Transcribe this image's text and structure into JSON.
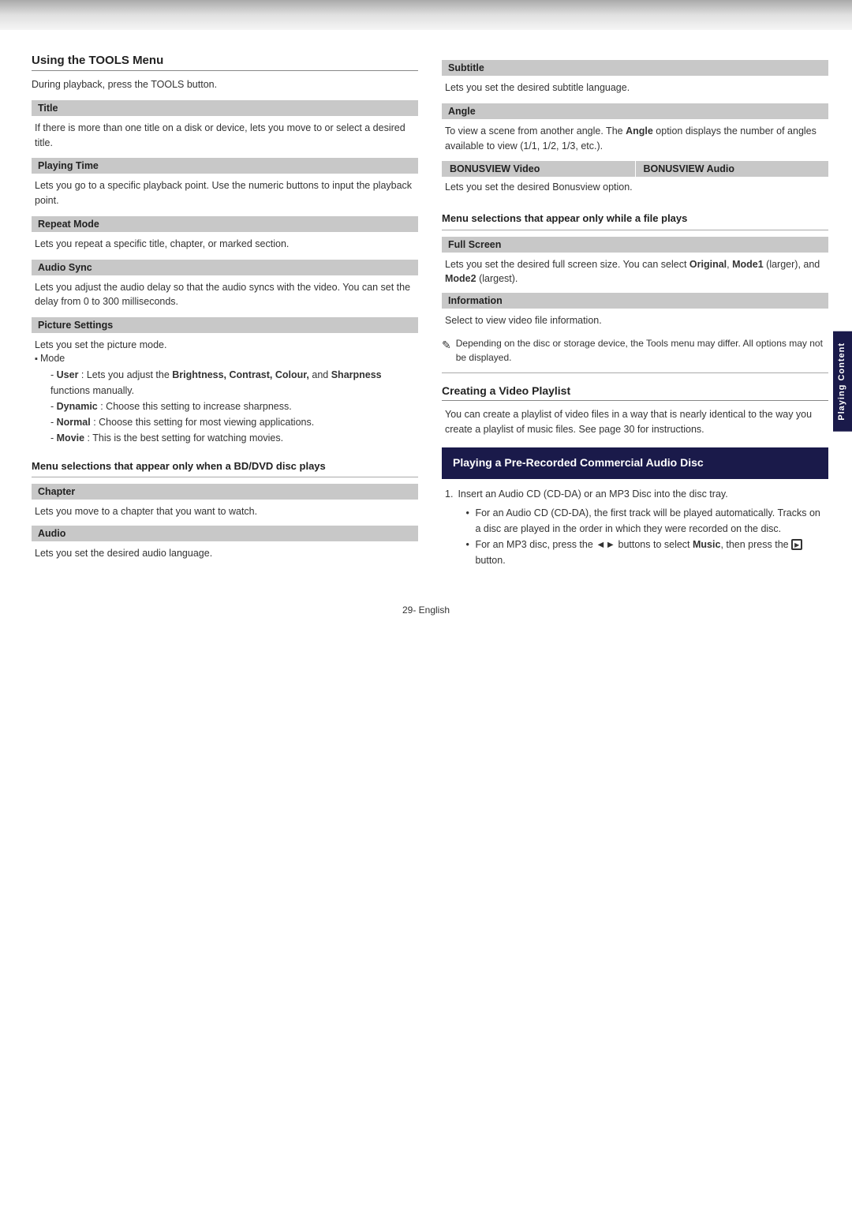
{
  "topBar": {},
  "leftCol": {
    "sectionTitle": "Using the TOOLS Menu",
    "sectionDesc": "During playback, press the TOOLS button.",
    "items": [
      {
        "label": "Title",
        "content": "If there is more than one title on a disk or device, lets you move to or select a desired title."
      },
      {
        "label": "Playing Time",
        "content": "Lets you go to a specific playback point. Use the numeric buttons to input the playback point."
      },
      {
        "label": "Repeat Mode",
        "content": "Lets you repeat a specific title, chapter, or marked section."
      },
      {
        "label": "Audio Sync",
        "content": "Lets you adjust the audio delay so that the audio syncs with the video. You can set the delay from 0 to 300 milliseconds."
      }
    ],
    "pictureSettings": {
      "label": "Picture Settings",
      "intro": "Lets you set the picture mode.",
      "bulletTitle": "Mode",
      "subItems": [
        {
          "text": "User : Lets you adjust the ",
          "bold1": "Brightness,",
          "text2": "",
          "bold2": "Contrast, Colour,",
          "text3": " and ",
          "bold3": "Sharpness",
          "text4": " functions manually."
        },
        {
          "text": "Dynamic : Choose this setting to increase sharpness."
        },
        {
          "text": "Normal : Choose this setting for most viewing applications."
        },
        {
          "text": "Movie : This is the best setting for watching movies."
        }
      ]
    },
    "menuBDDVD": {
      "heading": "Menu selections that appear only when a BD/DVD disc plays",
      "items": [
        {
          "label": "Chapter",
          "content": "Lets you move to a chapter that you want to watch."
        },
        {
          "label": "Audio",
          "content": "Lets you set the desired audio language."
        }
      ]
    }
  },
  "rightCol": {
    "subtitle": {
      "label": "Subtitle",
      "content": "Lets you set the desired subtitle language."
    },
    "angle": {
      "label": "Angle",
      "content": "To view a scene from another angle. The Angle option displays the number of angles available to view (1/1, 1/2, 1/3, etc.)."
    },
    "bonusview": {
      "col1": "BONUSVIEW Video",
      "col2": "BONUSVIEW Audio",
      "content": "Lets you set the desired Bonusview option."
    },
    "menuFile": {
      "heading": "Menu selections that appear only while a file plays",
      "items": [
        {
          "label": "Full Screen",
          "content": "Lets you set the desired full screen size. You can select Original, Mode1 (larger), and Mode2 (largest)."
        },
        {
          "label": "Information",
          "content": "Select to view video file information."
        }
      ]
    },
    "note": "Depending on the disc or storage device, the Tools menu may differ. All options may not be displayed.",
    "videoPlaylist": {
      "title": "Creating a Video Playlist",
      "content": "You can create a playlist of video files in a way that is nearly identical to the way you create a playlist of music files. See page 30 for instructions."
    },
    "preRecorded": {
      "boxTitle": "Playing a Pre-Recorded Commercial Audio Disc",
      "steps": [
        {
          "num": "1.",
          "text": "Insert an Audio CD (CD-DA) or an MP3 Disc into the disc tray.",
          "subBullets": [
            "For an Audio CD (CD-DA), the first track will be played automatically. Tracks on a disc are played in the order in which they were recorded on the disc.",
            "For an MP3 disc, press the ◄► buttons to select Music, then press the [disc] button."
          ]
        }
      ]
    },
    "sideTab": "Playing Content"
  },
  "footer": {
    "pageNum": "29",
    "text": "- English"
  }
}
